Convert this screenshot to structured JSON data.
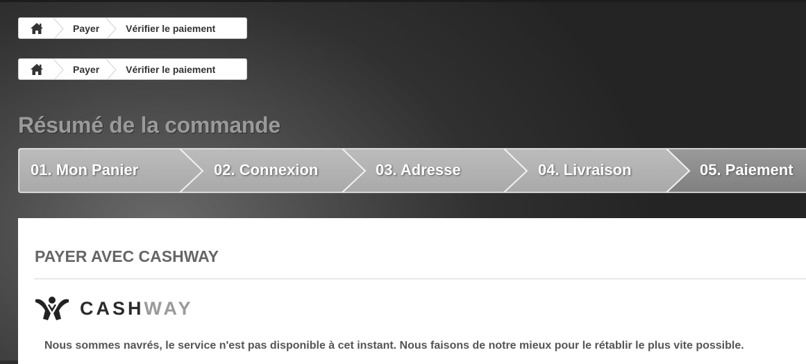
{
  "breadcrumbs": [
    {
      "home_icon": "home-icon",
      "items": [
        "Payer",
        "Vérifier le paiement"
      ]
    },
    {
      "home_icon": "home-icon",
      "items": [
        "Payer",
        "Vérifier le paiement"
      ]
    }
  ],
  "page_title": "Résumé de la commande",
  "steps": [
    {
      "label": "01. Mon Panier",
      "state": "done"
    },
    {
      "label": "02. Connexion",
      "state": "done"
    },
    {
      "label": "03. Adresse",
      "state": "done"
    },
    {
      "label": "04. Livraison",
      "state": "done"
    },
    {
      "label": "05. Paiement",
      "state": "current"
    }
  ],
  "panel": {
    "title": "PAYER AVEC CASHWAY",
    "logo": {
      "word_dark": "CASH",
      "word_light": "WAY",
      "icon": "cashway-logo-icon"
    },
    "message": "Nous sommes navrés, le service n'est pas disponible à cet instant. Nous faisons de notre mieux pour le rétablir le plus vite possible."
  },
  "colors": {
    "step_done": "#b3b3b3",
    "step_current": "#8e8e8e",
    "title_gray": "#9a9a9a"
  }
}
